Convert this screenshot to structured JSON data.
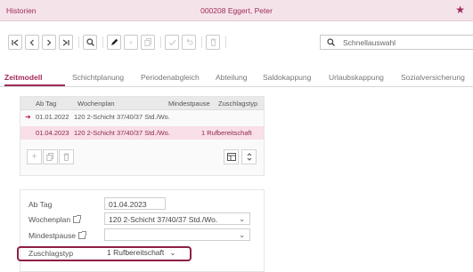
{
  "window": {
    "title": "Historien",
    "record": "000208  Eggert, Peter",
    "star_icon": "star-icon"
  },
  "search": {
    "placeholder": "Schnellauswahl"
  },
  "tabs": [
    {
      "label": "Zeitmodell",
      "active": true
    },
    {
      "label": "Schichtplanung"
    },
    {
      "label": "Periodenabgleich"
    },
    {
      "label": "Abteilung"
    },
    {
      "label": "Saldokappung"
    },
    {
      "label": "Urlaubskappung"
    },
    {
      "label": "Sozialversicherung"
    }
  ],
  "table": {
    "columns": [
      "Ab Tag",
      "Wochenplan",
      "Mindestpause",
      "Zuschlagstyp"
    ],
    "rows": [
      {
        "ab_tag": "01.01.2022",
        "wochenplan": "120 2-Schicht 37/40/37 Std./Wo.",
        "mindestpause": "",
        "zuschlagstyp": "",
        "current": true
      },
      {
        "ab_tag": "01.04.2023",
        "wochenplan": "120 2-Schicht 37/40/37 Std./Wo.",
        "mindestpause": "",
        "zuschlagstyp": "1 Rufbereitschaft",
        "selected": true
      }
    ]
  },
  "form": {
    "ab_tag": {
      "label": "Ab Tag",
      "value": "01.04.2023"
    },
    "wochenplan": {
      "label": "Wochenplan",
      "value": "120 2-Schicht 37/40/37 Std./Wo."
    },
    "mindestpause": {
      "label": "Mindestpause",
      "value": ""
    },
    "zuschlagstyp": {
      "label": "Zuschlagstyp",
      "value": "1 Rufbereitschaft"
    }
  },
  "colors": {
    "accent": "#a02c5a",
    "title_bg": "#f5e3ea",
    "selected_row": "#f9dfe7",
    "highlight_border": "#8e1f45"
  }
}
